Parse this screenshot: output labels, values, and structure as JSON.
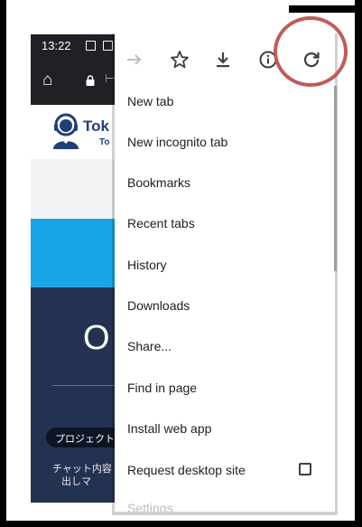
{
  "status": {
    "time": "13:22"
  },
  "browser": {
    "url_fragment": "⊢"
  },
  "site": {
    "brand": "Tok",
    "brand_sub": "To",
    "big_text": "O",
    "tag": "プロジェクト:",
    "line1": "チャット内容",
    "line2": "出しマ"
  },
  "menu": {
    "toolbar_icons": [
      "forward-icon",
      "star-icon",
      "download-icon",
      "info-icon",
      "refresh-icon"
    ],
    "items": [
      {
        "label": "New tab"
      },
      {
        "label": "New incognito tab"
      },
      {
        "label": "Bookmarks"
      },
      {
        "label": "Recent tabs"
      },
      {
        "label": "History"
      },
      {
        "label": "Downloads"
      },
      {
        "label": "Share..."
      },
      {
        "label": "Find in page"
      },
      {
        "label": "Install web app"
      },
      {
        "label": "Request desktop site"
      }
    ],
    "request_desktop_checked": false,
    "partial_item": "Settings"
  },
  "colors": {
    "highlight": "#c15a5a",
    "navy": "#243252",
    "blue_band": "#1aa6e6",
    "status_bar": "#202124"
  }
}
